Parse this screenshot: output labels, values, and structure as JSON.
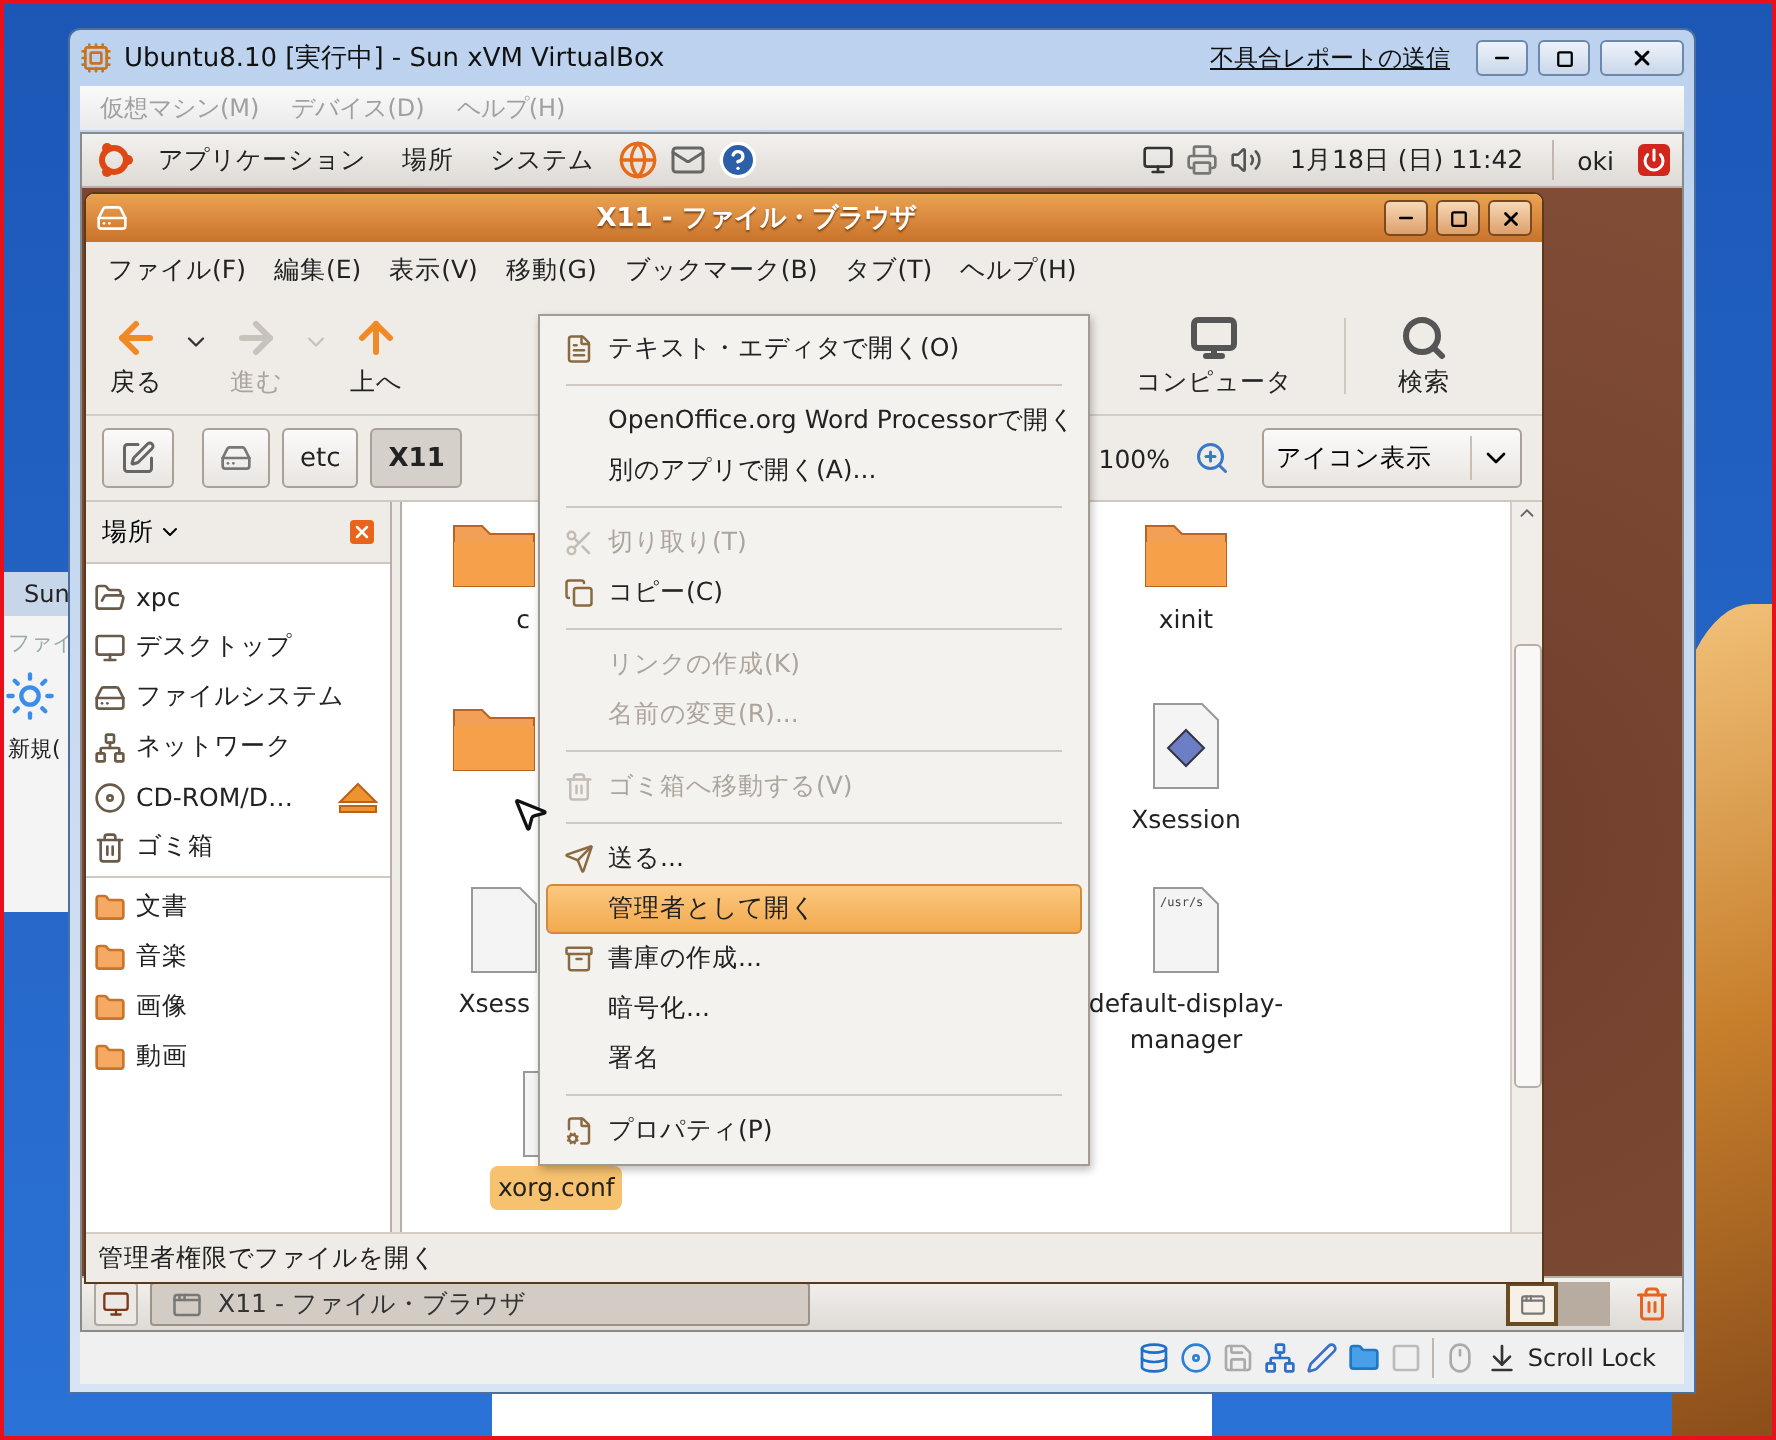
{
  "background_window": {
    "title": "Sun",
    "menu": "ファイ",
    "item": "新規("
  },
  "vbox_window": {
    "title": "Ubuntu8.10 [実行中] - Sun xVM VirtualBox",
    "report_link": "不具合レポートの送信",
    "menu": [
      {
        "label": "仮想マシン(M)",
        "disabled": true
      },
      {
        "label": "デバイス(D)",
        "disabled": true
      },
      {
        "label": "ヘルプ(H)",
        "disabled": true
      }
    ],
    "status_bar": {
      "scroll_lock": "Scroll Lock"
    }
  },
  "top_panel": {
    "menus": [
      "アプリケーション",
      "場所",
      "システム"
    ],
    "clock": "1月18日 (日) 11:42",
    "user": "oki"
  },
  "file_browser": {
    "title": "X11 - ファイル・ブラウザ",
    "menu": [
      "ファイル(F)",
      "編集(E)",
      "表示(V)",
      "移動(G)",
      "ブックマーク(B)",
      "タブ(T)",
      "ヘルプ(H)"
    ],
    "toolbar": [
      {
        "label": "戻る",
        "disabled": false,
        "dropdown": true
      },
      {
        "label": "進む",
        "disabled": true,
        "dropdown": true
      },
      {
        "label": "上へ",
        "disabled": false,
        "dropdown": false
      },
      {
        "label": "コンピュータ",
        "disabled": false,
        "dropdown": false
      },
      {
        "label": "検索",
        "disabled": false,
        "dropdown": false
      }
    ],
    "path": [
      {
        "label": "etc",
        "selected": false
      },
      {
        "label": "X11",
        "selected": true
      }
    ],
    "zoom": "100%",
    "view": "アイコン表示",
    "sidebar": {
      "title": "場所",
      "items": [
        {
          "label": "xpc",
          "eject": false
        },
        {
          "label": "デスクトップ",
          "eject": false
        },
        {
          "label": "ファイルシステム",
          "eject": false
        },
        {
          "label": "ネットワーク",
          "eject": false
        },
        {
          "label": "CD-ROM/D…",
          "eject": true
        },
        {
          "label": "ゴミ箱",
          "eject": false
        }
      ],
      "bookmarks": [
        "文書",
        "音楽",
        "画像",
        "動画"
      ]
    },
    "icons": [
      {
        "label": "c",
        "kind": "folder",
        "selected": false
      },
      {
        "label": "xinit",
        "kind": "folder",
        "selected": false
      },
      {
        "kind": "folder",
        "selected": false
      },
      {
        "label": "Xsession",
        "kind": "script",
        "selected": false
      },
      {
        "label": "Xsess",
        "kind": "file",
        "selected": false
      },
      {
        "label": "default-display-manager",
        "kind": "text",
        "preview": "/usr/s",
        "selected": false
      },
      {
        "label": "xorg.conf",
        "kind": "file",
        "selected": true
      }
    ],
    "status": "管理者権限でファイルを開く"
  },
  "context_menu": {
    "items": [
      {
        "kind": "item",
        "label": "テキスト・エディタで開く(O)",
        "disabled": false,
        "selected": false
      },
      {
        "kind": "separator"
      },
      {
        "kind": "item",
        "label": "OpenOffice.org Word Processorで開く",
        "disabled": false,
        "selected": false
      },
      {
        "kind": "item",
        "label": "別のアプリで開く(A)...",
        "disabled": false,
        "selected": false
      },
      {
        "kind": "separator"
      },
      {
        "kind": "item",
        "label": "切り取り(T)",
        "disabled": true,
        "selected": false
      },
      {
        "kind": "item",
        "label": "コピー(C)",
        "disabled": false,
        "selected": false
      },
      {
        "kind": "separator"
      },
      {
        "kind": "item",
        "label": "リンクの作成(K)",
        "disabled": true,
        "selected": false
      },
      {
        "kind": "item",
        "label": "名前の変更(R)...",
        "disabled": true,
        "selected": false
      },
      {
        "kind": "separator"
      },
      {
        "kind": "item",
        "label": "ゴミ箱へ移動する(V)",
        "disabled": true,
        "selected": false
      },
      {
        "kind": "separator"
      },
      {
        "kind": "item",
        "label": "送る...",
        "disabled": false,
        "selected": false
      },
      {
        "kind": "item",
        "label": "管理者として開く",
        "disabled": false,
        "selected": true
      },
      {
        "kind": "item",
        "label": "書庫の作成...",
        "disabled": false,
        "selected": false
      },
      {
        "kind": "item",
        "label": "暗号化...",
        "disabled": false,
        "selected": false
      },
      {
        "kind": "item",
        "label": "署名",
        "disabled": false,
        "selected": false
      },
      {
        "kind": "separator"
      },
      {
        "kind": "item",
        "label": "プロパティ(P)",
        "disabled": false,
        "selected": false
      }
    ]
  },
  "bottom_panel": {
    "tasks": [
      {
        "label": "X11 - ファイル・ブラウザ",
        "selected": true
      }
    ],
    "workspaces": [
      {
        "selected": true
      },
      {
        "selected": false
      }
    ]
  }
}
